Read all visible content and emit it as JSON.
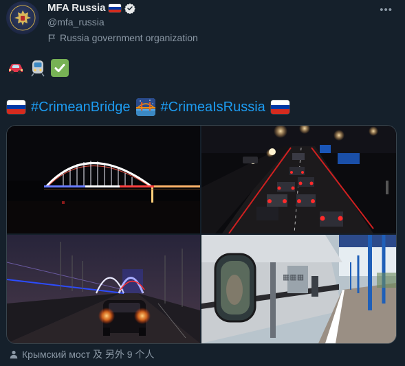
{
  "account": {
    "name": "MFA Russia",
    "handle": "@mfa_russia",
    "label": "Russia government organization",
    "avatar_icon": "coat-of-arms-icon",
    "verified_color": "#e7e9ea"
  },
  "tweet": {
    "emoji": [
      "car-icon",
      "train-icon",
      "check-mark-icon"
    ],
    "hashtags": [
      "#CrimeanBridge",
      "#CrimeaIsRussia"
    ],
    "hashtag_color": "#1d9bf0"
  },
  "media": {
    "images": [
      {
        "name": "bridge-arch-night-image"
      },
      {
        "name": "bridge-traffic-night-image"
      },
      {
        "name": "bridge-car-tail-lights-image"
      },
      {
        "name": "train-platform-image"
      }
    ]
  },
  "footer": {
    "tagged": "Крымский мост 及 另外 9 个人"
  },
  "flag_colors": [
    "#ffffff",
    "#0039a6",
    "#d52b1e"
  ]
}
